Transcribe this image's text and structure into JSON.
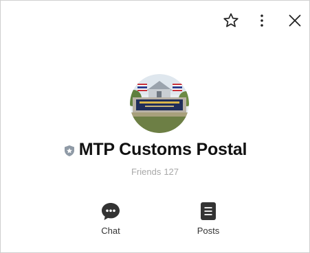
{
  "profile": {
    "name": "MTP Customs Postal",
    "friends_label": "Friends",
    "friends_count": "127"
  },
  "actions": {
    "chat_label": "Chat",
    "posts_label": "Posts"
  },
  "icons": {
    "favorite": "star-outline-icon",
    "more": "more-vertical-icon",
    "close": "close-icon",
    "badge": "shield-badge-icon",
    "chat": "chat-bubble-icon",
    "posts": "posts-icon"
  },
  "colors": {
    "text_primary": "#111111",
    "text_secondary": "#a8a8a8",
    "icon_dark": "#333333",
    "badge_gray": "#8f9aa6"
  }
}
